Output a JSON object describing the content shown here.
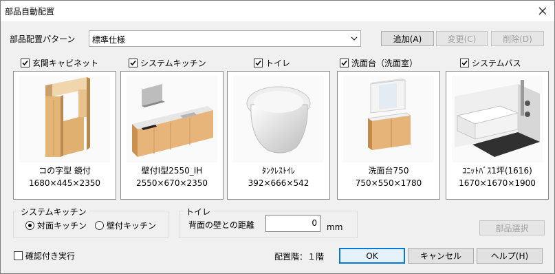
{
  "window": {
    "title": "部品自動配置"
  },
  "pattern": {
    "label": "部品配置パターン",
    "selected": "標準仕様"
  },
  "buttons": {
    "add": "追加(A)",
    "change": "変更(C)",
    "delete": "削除(D)",
    "select_part": "部品選択",
    "ok": "OK",
    "cancel": "キャンセル",
    "help": "ヘルプ(H)"
  },
  "categories": [
    {
      "label": "玄関キャビネット",
      "checked": true,
      "name": "コの字型 鏡付",
      "dims": "1680×445×2350"
    },
    {
      "label": "システムキッチン",
      "checked": true,
      "name": "壁付I型2550_IH",
      "dims": "2550×670×2350"
    },
    {
      "label": "トイレ",
      "checked": true,
      "name": "ﾀﾝｸﾚｽﾄｲﾚ",
      "dims": "392×666×542"
    },
    {
      "label": "洗面台（洗面室）",
      "checked": true,
      "name": "洗面台750",
      "dims": "750×550×1780"
    },
    {
      "label": "システムバス",
      "checked": true,
      "name": "ﾕﾆｯﾄﾊﾞｽ1坪(1616)",
      "dims": "1670×1670×1900"
    }
  ],
  "kitchen_group": {
    "title": "システムキッチン",
    "option1": "対面キッチン",
    "option2": "壁付キッチン",
    "selected": "対面キッチン"
  },
  "toilet_group": {
    "title": "トイレ",
    "distance_label": "背面の壁との距離",
    "distance_value": "0",
    "unit": "mm"
  },
  "confirm": {
    "label": "確認付き実行",
    "checked": false
  },
  "floor": {
    "label": "配置階：１階"
  }
}
